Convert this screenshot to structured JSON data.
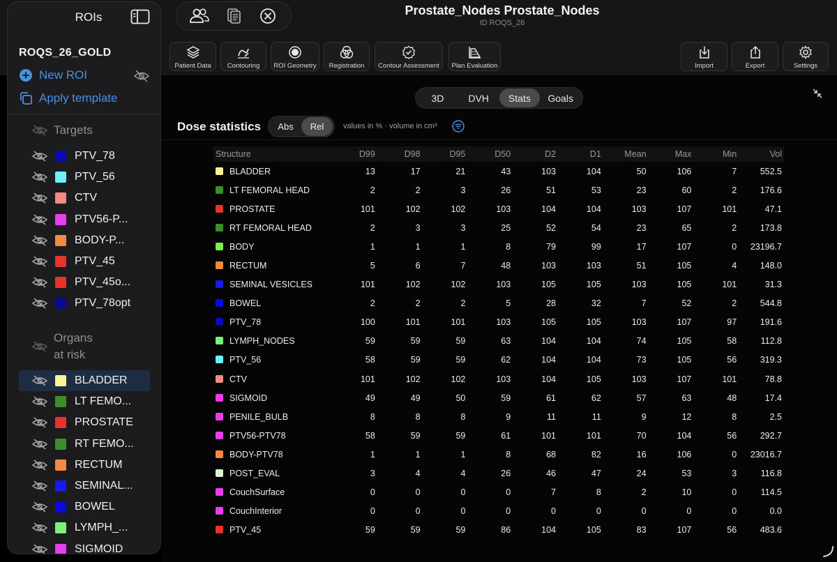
{
  "sidebar": {
    "title": "ROIs",
    "case_name": "ROQS_26_GOLD",
    "new_roi_label": "New ROI",
    "apply_template_label": "Apply template",
    "sections": {
      "targets": "Targets",
      "organs_line1": "Organs",
      "organs_line2": "at risk"
    },
    "targets": [
      {
        "label": "PTV_78",
        "color": "#0a0ab8"
      },
      {
        "label": "PTV_56",
        "color": "#6ef0f5"
      },
      {
        "label": "CTV",
        "color": "#f08a82"
      },
      {
        "label": "PTV56-P...",
        "color": "#e83ee8"
      },
      {
        "label": "BODY-P...",
        "color": "#f08a40"
      },
      {
        "label": "PTV_45",
        "color": "#e8332a"
      },
      {
        "label": "PTV_45o...",
        "color": "#e8332a"
      },
      {
        "label": "PTV_78opt",
        "color": "#0a0a90"
      }
    ],
    "organs": [
      {
        "label": "BLADDER",
        "color": "#f8f592",
        "selected": true
      },
      {
        "label": "LT FEMO...",
        "color": "#3a8f2a"
      },
      {
        "label": "PROSTATE",
        "color": "#e8332a"
      },
      {
        "label": "RT FEMO...",
        "color": "#3a8f2a"
      },
      {
        "label": "RECTUM",
        "color": "#f08a40"
      },
      {
        "label": "SEMINAL...",
        "color": "#1a1ae8"
      },
      {
        "label": "BOWEL",
        "color": "#0a0ae0"
      },
      {
        "label": "LYMPH_...",
        "color": "#7af07a"
      },
      {
        "label": "SIGMOID",
        "color": "#e83ee8"
      }
    ]
  },
  "header": {
    "title": "Prostate_Nodes Prostate_Nodes",
    "subtitle": "ID ROQS_26",
    "tools_left": [
      {
        "label": "Patient Data",
        "icon": "layers-icon"
      },
      {
        "label": "Contouring",
        "icon": "pen-icon"
      },
      {
        "label": "ROI Geometry",
        "icon": "atom-icon"
      },
      {
        "label": "Registration",
        "icon": "registration-icon"
      },
      {
        "label": "Contour Assessment",
        "icon": "badge-check-icon"
      },
      {
        "label": "Plan Evaluation",
        "icon": "chart-area-icon"
      }
    ],
    "tools_right": [
      {
        "label": "Import",
        "icon": "import-icon"
      },
      {
        "label": "Export",
        "icon": "export-icon"
      },
      {
        "label": "Settings",
        "icon": "gear-icon"
      }
    ]
  },
  "view_tabs": [
    "3D",
    "DVH",
    "Stats",
    "Goals"
  ],
  "view_tab_active": "Stats",
  "dose_statistics": {
    "title": "Dose statistics",
    "abs_label": "Abs",
    "rel_label": "Rel",
    "active_mode": "Rel",
    "units_note": "values in % · volume in cm³",
    "columns": [
      "Structure",
      "D99",
      "D98",
      "D95",
      "D50",
      "D2",
      "D1",
      "Mean",
      "Max",
      "Min",
      "Vol"
    ],
    "rows": [
      {
        "name": "BLADDER",
        "color": "#f8f592",
        "v": [
          "13",
          "17",
          "21",
          "43",
          "103",
          "104",
          "50",
          "106",
          "7",
          "552.5"
        ]
      },
      {
        "name": "LT FEMORAL HEAD",
        "color": "#3a8f2a",
        "v": [
          "2",
          "2",
          "3",
          "26",
          "51",
          "53",
          "23",
          "60",
          "2",
          "176.6"
        ]
      },
      {
        "name": "PROSTATE",
        "color": "#e8332a",
        "v": [
          "101",
          "102",
          "102",
          "103",
          "104",
          "104",
          "103",
          "107",
          "101",
          "47.1"
        ]
      },
      {
        "name": "RT FEMORAL HEAD",
        "color": "#3a8f2a",
        "v": [
          "2",
          "3",
          "3",
          "25",
          "52",
          "54",
          "23",
          "65",
          "2",
          "173.8"
        ]
      },
      {
        "name": "BODY",
        "color": "#7af050",
        "v": [
          "1",
          "1",
          "1",
          "8",
          "79",
          "99",
          "17",
          "107",
          "0",
          "23196.7"
        ]
      },
      {
        "name": "RECTUM",
        "color": "#f08a40",
        "v": [
          "5",
          "6",
          "7",
          "48",
          "103",
          "103",
          "51",
          "105",
          "4",
          "148.0"
        ]
      },
      {
        "name": "SEMINAL VESICLES",
        "color": "#1a1ae8",
        "v": [
          "101",
          "102",
          "102",
          "103",
          "105",
          "105",
          "103",
          "105",
          "101",
          "31.3"
        ]
      },
      {
        "name": "BOWEL",
        "color": "#0a0ae0",
        "v": [
          "2",
          "2",
          "2",
          "5",
          "28",
          "32",
          "7",
          "52",
          "2",
          "544.8"
        ]
      },
      {
        "name": "PTV_78",
        "color": "#0a0ab8",
        "v": [
          "100",
          "101",
          "101",
          "103",
          "105",
          "105",
          "103",
          "107",
          "97",
          "191.6"
        ]
      },
      {
        "name": "LYMPH_NODES",
        "color": "#7af07a",
        "v": [
          "59",
          "59",
          "59",
          "63",
          "104",
          "104",
          "74",
          "105",
          "58",
          "112.8"
        ]
      },
      {
        "name": "PTV_56",
        "color": "#6ef0f5",
        "v": [
          "58",
          "59",
          "59",
          "62",
          "104",
          "104",
          "73",
          "105",
          "56",
          "319.3"
        ]
      },
      {
        "name": "CTV",
        "color": "#f08a82",
        "v": [
          "101",
          "102",
          "102",
          "103",
          "104",
          "105",
          "103",
          "107",
          "101",
          "78.8"
        ]
      },
      {
        "name": "SIGMOID",
        "color": "#e83ee8",
        "v": [
          "49",
          "49",
          "50",
          "59",
          "61",
          "62",
          "57",
          "63",
          "48",
          "17.4"
        ]
      },
      {
        "name": "PENILE_BULB",
        "color": "#e83ee8",
        "v": [
          "8",
          "8",
          "8",
          "9",
          "11",
          "11",
          "9",
          "12",
          "8",
          "2.5"
        ]
      },
      {
        "name": "PTV56-PTV78",
        "color": "#e83ee8",
        "v": [
          "58",
          "59",
          "59",
          "61",
          "101",
          "101",
          "70",
          "104",
          "56",
          "292.7"
        ]
      },
      {
        "name": "BODY-PTV78",
        "color": "#f08a40",
        "v": [
          "1",
          "1",
          "1",
          "8",
          "68",
          "82",
          "16",
          "106",
          "0",
          "23016.7"
        ]
      },
      {
        "name": "POST_EVAL",
        "color": "#d8f5d0",
        "v": [
          "3",
          "4",
          "4",
          "26",
          "46",
          "47",
          "24",
          "53",
          "3",
          "116.8"
        ]
      },
      {
        "name": "CouchSurface",
        "color": "#e83ee8",
        "v": [
          "0",
          "0",
          "0",
          "0",
          "7",
          "8",
          "2",
          "10",
          "0",
          "114.5"
        ]
      },
      {
        "name": "CouchInterior",
        "color": "#e83ee8",
        "v": [
          "0",
          "0",
          "0",
          "0",
          "0",
          "0",
          "0",
          "0",
          "0",
          "0.0"
        ]
      },
      {
        "name": "PTV_45",
        "color": "#e8332a",
        "v": [
          "59",
          "59",
          "59",
          "86",
          "104",
          "105",
          "83",
          "107",
          "56",
          "483.6"
        ]
      }
    ]
  },
  "colors": {
    "accent": "#4a90e2",
    "selected_row": "#1f2d44"
  }
}
